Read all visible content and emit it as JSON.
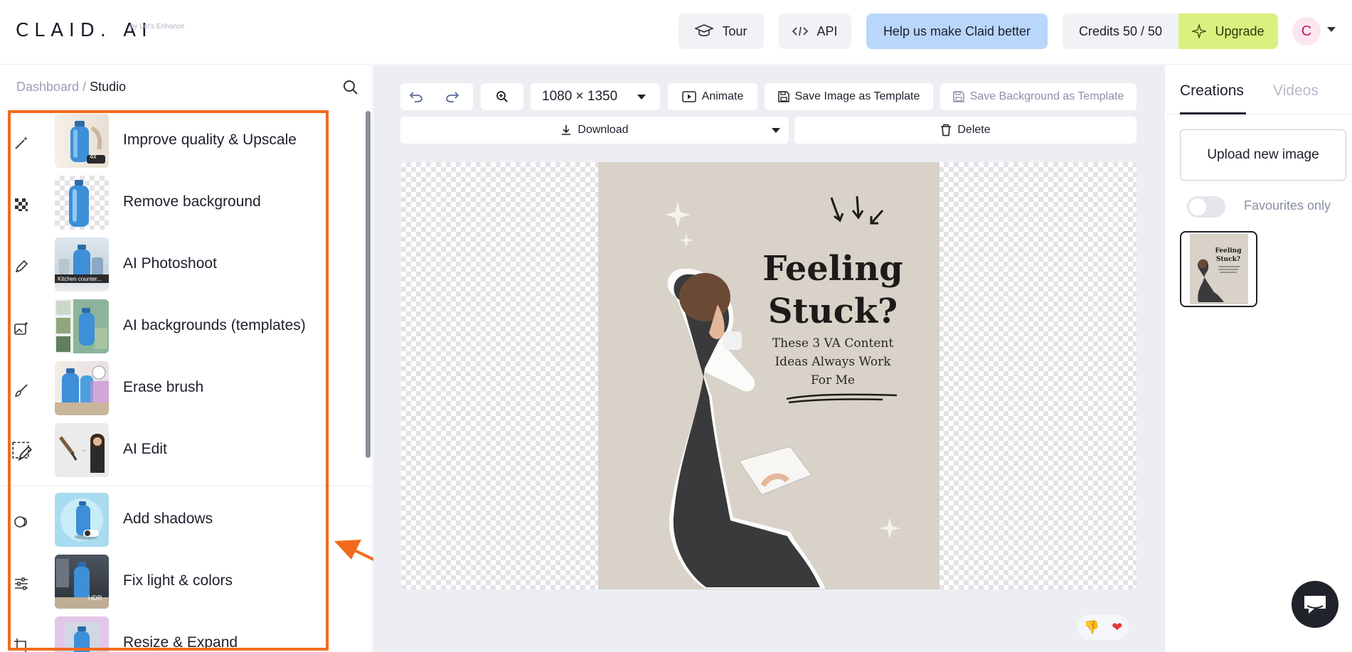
{
  "header": {
    "logo": "CLAID. AI",
    "logo_sub": "by Let's Enhance",
    "tour": "Tour",
    "api": "API",
    "help": "Help us make Claid better",
    "credits": "Credits 50 / 50",
    "upgrade": "Upgrade",
    "avatar": "C"
  },
  "sidebar": {
    "breadcrumb_root": "Dashboard",
    "breadcrumb_sep": " / ",
    "breadcrumb_current": "Studio",
    "tools": [
      {
        "label": "Improve quality & Upscale",
        "icon": "magic-wand-icon",
        "badge": "4x"
      },
      {
        "label": "Remove background",
        "icon": "checker-icon"
      },
      {
        "label": "AI Photoshoot",
        "icon": "pen-sparkle-icon",
        "badge": "Kitchen counter..."
      },
      {
        "label": "AI backgrounds (templates)",
        "icon": "image-sparkle-icon"
      },
      {
        "label": "Erase brush",
        "icon": "brush-icon"
      },
      {
        "label": "AI Edit",
        "icon": "select-pen-icon"
      },
      {
        "label": "Add shadows",
        "icon": "shadow-icon"
      },
      {
        "label": "Fix light & colors",
        "icon": "sliders-icon",
        "badge": "HDR"
      },
      {
        "label": "Resize & Expand",
        "icon": "crop-icon"
      }
    ]
  },
  "toolbar": {
    "size": "1080 × 1350",
    "animate": "Animate",
    "save_template": "Save Image as Template",
    "save_background": "Save Background as Template",
    "download": "Download",
    "delete": "Delete"
  },
  "poster": {
    "title": "Feeling Stuck?",
    "subtitle": "These 3 VA Content Ideas Always Work For Me"
  },
  "right_panel": {
    "tab_creations": "Creations",
    "tab_videos": "Videos",
    "upload": "Upload new image",
    "favourites": "Favourites only"
  },
  "colors": {
    "highlight": "#f26a1b",
    "help_bg": "#b9d6fb",
    "upgrade_bg": "#d8f17f"
  }
}
